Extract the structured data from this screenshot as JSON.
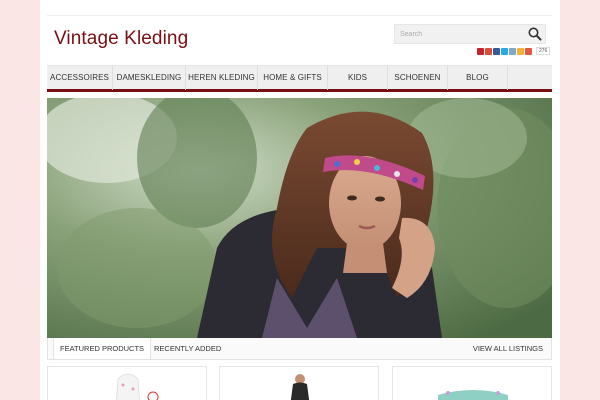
{
  "site": {
    "title": "Vintage Kleding"
  },
  "search": {
    "placeholder": "Search",
    "icon": "magnifier"
  },
  "social": {
    "icons": [
      {
        "name": "pinterest-icon",
        "color": "#c8232c"
      },
      {
        "name": "google-plus-icon",
        "color": "#dd4b39"
      },
      {
        "name": "facebook-icon",
        "color": "#3b5998"
      },
      {
        "name": "twitter-icon",
        "color": "#2aa9e0"
      },
      {
        "name": "email-icon",
        "color": "#7fa8c8"
      },
      {
        "name": "rss-icon",
        "color": "#f4b134"
      },
      {
        "name": "share-plus-icon",
        "color": "#e4573d"
      }
    ],
    "count": "276"
  },
  "nav": {
    "items": [
      {
        "label": "ACCESSOIRES"
      },
      {
        "label": "DAMESKLEDING"
      },
      {
        "label": "HEREN KLEDING"
      },
      {
        "label": "HOME & GIFTS"
      },
      {
        "label": "KIDS"
      },
      {
        "label": "SCHOENEN"
      },
      {
        "label": "BLOG"
      }
    ]
  },
  "tabs": {
    "featured": "FEATURED PRODUCTS",
    "recent": "RECENTLY ADDED",
    "view_all": "VIEW ALL LISTINGS"
  },
  "colors": {
    "brand": "#7a0f12",
    "page_bg": "#fbe6e6"
  }
}
